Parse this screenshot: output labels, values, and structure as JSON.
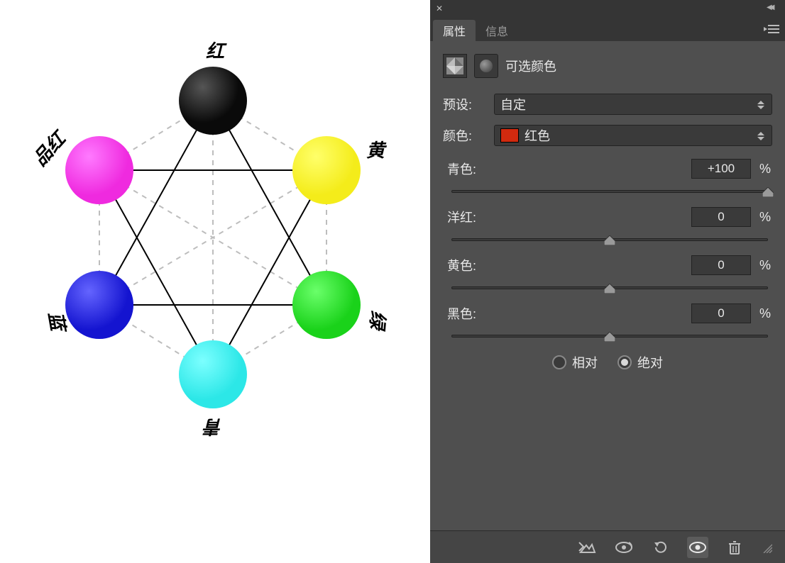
{
  "diagram": {
    "labels": {
      "top": "红",
      "tr": "黄",
      "br": "绿",
      "bottom": "青",
      "bl": "蓝",
      "tl": "品红"
    },
    "colors": {
      "top": "#0a0a0a",
      "tr": "#f4ec1a",
      "br": "#1ad21a",
      "bottom": "#2ce7e7",
      "bl": "#1414d0",
      "tl": "#ef2adf"
    }
  },
  "tabs": {
    "properties": "属性",
    "info": "信息"
  },
  "adjustment": {
    "name": "可选颜色"
  },
  "preset": {
    "label": "预设:",
    "value": "自定"
  },
  "color": {
    "label": "颜色:",
    "value": "红色",
    "swatch": "#d12a0f"
  },
  "sliders": {
    "cyan": {
      "label": "青色:",
      "value": "+100",
      "pct": "%",
      "pos": 100
    },
    "magenta": {
      "label": "洋红:",
      "value": "0",
      "pct": "%",
      "pos": 50
    },
    "yellow": {
      "label": "黄色:",
      "value": "0",
      "pct": "%",
      "pos": 50
    },
    "black": {
      "label": "黑色:",
      "value": "0",
      "pct": "%",
      "pos": 50
    }
  },
  "method": {
    "relative": "相对",
    "absolute": "绝对",
    "selected": "absolute"
  }
}
